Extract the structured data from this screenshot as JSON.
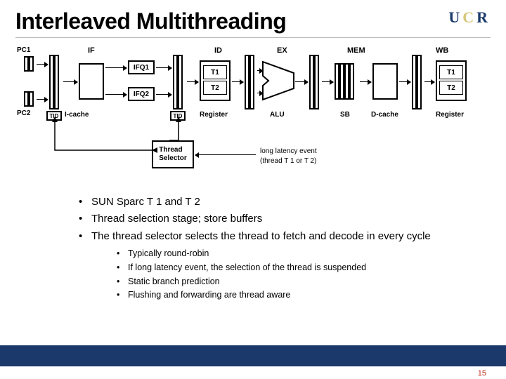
{
  "title": "Interleaved Multithreading",
  "logo": {
    "u": "U",
    "c": "C",
    "r": "R"
  },
  "stages": {
    "IF": "IF",
    "ID": "ID",
    "EX": "EX",
    "MEM": "MEM",
    "WB": "WB"
  },
  "blocks": {
    "PC1": "PC1",
    "PC2": "PC2",
    "Icache": "I-cache",
    "IFQ1": "IFQ1",
    "IFQ2": "IFQ2",
    "T1a": "T1",
    "T2a": "T2",
    "T1b": "T1",
    "T2b": "T2",
    "Register1": "Register",
    "Register2": "Register",
    "ALU": "ALU",
    "SB": "SB",
    "Dcache": "D-cache",
    "TID1": "TID",
    "TID2": "TID",
    "ThreadSelector": "Thread\nSelector"
  },
  "annotations": {
    "long_latency": "long latency event",
    "thread_T1_T2": "(thread T 1 or T 2)"
  },
  "bullets": {
    "b1": "SUN Sparc T 1 and T 2",
    "b2": "Thread selection stage; store buffers",
    "b3": "The thread selector selects the thread to fetch and decode in every cycle",
    "s1": "Typically round-robin",
    "s2": "If long latency event, the selection of the thread is suspended",
    "s3": "Static branch prediction",
    "s4": "Flushing and forwarding are thread aware"
  },
  "page": "15"
}
